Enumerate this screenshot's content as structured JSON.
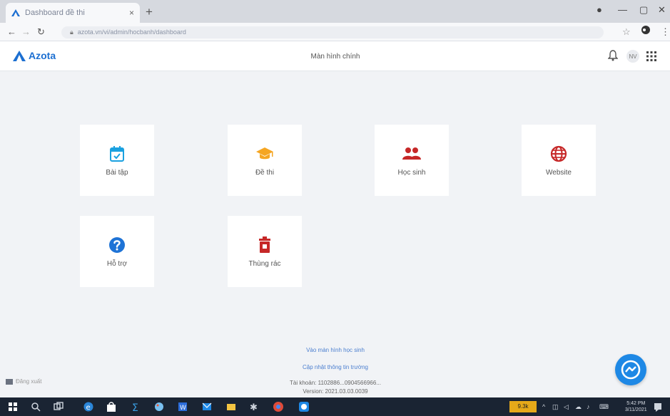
{
  "browser": {
    "tab_title": "Dashboard đề thi",
    "url": "azota.vn/vi/admin/hocbanh/dashboard",
    "new_tab": "+",
    "close_tab": "×"
  },
  "app": {
    "brand": "Azota",
    "title": "Màn hình chính",
    "avatar": "NV"
  },
  "cards": [
    {
      "label": "Bài tập",
      "icon": "calendar-check-icon",
      "color": "#1aa1e0"
    },
    {
      "label": "Đề thi",
      "icon": "graduation-cap-icon",
      "color": "#f5a623"
    },
    {
      "label": "Học sinh",
      "icon": "users-icon",
      "color": "#c62828"
    },
    {
      "label": "Website",
      "icon": "globe-icon",
      "color": "#c62828"
    },
    {
      "label": "Hỗ trợ",
      "icon": "help-icon",
      "color": "#1e73d6"
    },
    {
      "label": "Thùng rác",
      "icon": "trash-icon",
      "color": "#c62828"
    }
  ],
  "footer": {
    "link1": "Vào màn hình học sinh",
    "link2": "Cập nhật thông tin trường",
    "account": "Tài khoản: 1102886...0904566966...",
    "version": "Version: 2021.03.03.0039"
  },
  "logout": "Đăng xuất",
  "taskbar": {
    "time": "5:42 PM",
    "date": "3/11/2021",
    "badge": "9.3k"
  }
}
